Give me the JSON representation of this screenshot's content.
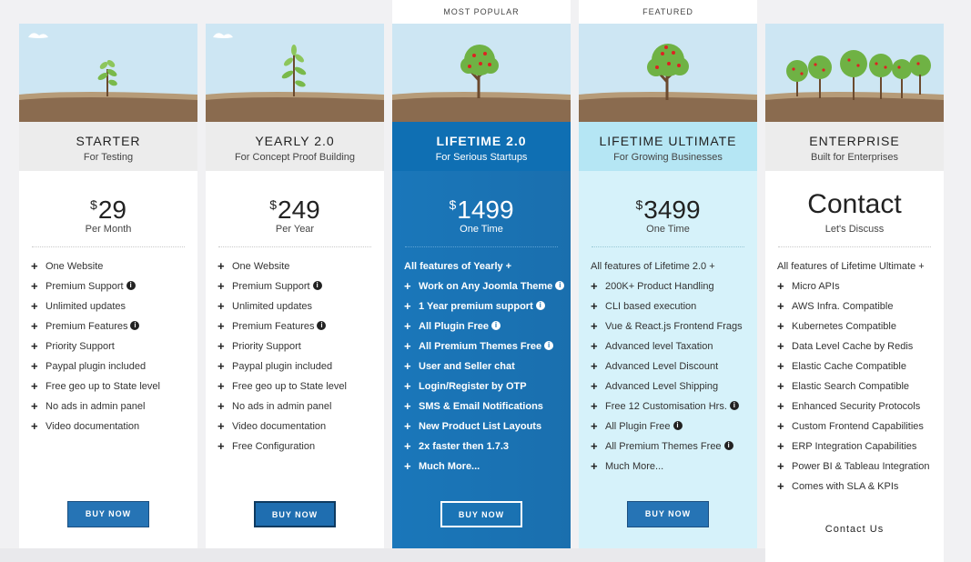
{
  "plans": [
    {
      "title": "STARTER",
      "subtitle": "For Testing",
      "currency": "$",
      "price": "29",
      "period": "Per Month",
      "features": [
        {
          "text": "One Website",
          "info": false
        },
        {
          "text": "Premium Support",
          "info": true
        },
        {
          "text": "Unlimited updates",
          "info": false
        },
        {
          "text": "Premium Features",
          "info": true
        },
        {
          "text": "Priority Support",
          "info": false
        },
        {
          "text": "Paypal plugin included",
          "info": false
        },
        {
          "text": "Free geo up to State level",
          "info": false
        },
        {
          "text": "No ads in admin panel",
          "info": false
        },
        {
          "text": "Video documentation",
          "info": false
        }
      ],
      "button": "BUY NOW"
    },
    {
      "title": "YEARLY 2.0",
      "subtitle": "For Concept Proof Building",
      "currency": "$",
      "price": "249",
      "period": "Per Year",
      "features": [
        {
          "text": "One Website",
          "info": false
        },
        {
          "text": "Premium Support",
          "info": true
        },
        {
          "text": "Unlimited updates",
          "info": false
        },
        {
          "text": "Premium Features",
          "info": true
        },
        {
          "text": "Priority Support",
          "info": false
        },
        {
          "text": "Paypal plugin included",
          "info": false
        },
        {
          "text": "Free geo up to State level",
          "info": false
        },
        {
          "text": "No ads in admin panel",
          "info": false
        },
        {
          "text": "Video documentation",
          "info": false
        },
        {
          "text": "Free Configuration",
          "info": false
        }
      ],
      "button": "BUY NOW"
    },
    {
      "ribbon": "MOST POPULAR",
      "title": "LIFETIME 2.0",
      "subtitle": "For Serious Startups",
      "currency": "$",
      "price": "1499",
      "period": "One Time",
      "intro": "All features of Yearly +",
      "features": [
        {
          "text": "Work on Any Joomla Theme",
          "info": true
        },
        {
          "text": "1 Year premium support",
          "info": true
        },
        {
          "text": "All Plugin Free",
          "info": true
        },
        {
          "text": "All Premium Themes Free",
          "info": true
        },
        {
          "text": "User and Seller chat",
          "info": false
        },
        {
          "text": "Login/Register by OTP",
          "info": false
        },
        {
          "text": "SMS & Email Notifications",
          "info": false
        },
        {
          "text": "New Product List Layouts",
          "info": false
        },
        {
          "text": "2x faster then 1.7.3",
          "info": false
        },
        {
          "text": "Much More...",
          "info": false
        }
      ],
      "button": "BUY NOW"
    },
    {
      "ribbon": "FEATURED",
      "title": "LIFETIME ULTIMATE",
      "subtitle": "For Growing Businesses",
      "currency": "$",
      "price": "3499",
      "period": "One Time",
      "intro": "All features of Lifetime 2.0 +",
      "features": [
        {
          "text": "200K+ Product Handling",
          "info": false
        },
        {
          "text": "CLI based execution",
          "info": false
        },
        {
          "text": "Vue & React.js Frontend Frags",
          "info": false
        },
        {
          "text": "Advanced level Taxation",
          "info": false
        },
        {
          "text": "Advanced Level Discount",
          "info": false
        },
        {
          "text": "Advanced Level Shipping",
          "info": false
        },
        {
          "text": "Free 12 Customisation Hrs.",
          "info": true
        },
        {
          "text": "All Plugin Free",
          "info": true
        },
        {
          "text": "All Premium Themes Free",
          "info": true
        },
        {
          "text": "Much More...",
          "info": false
        }
      ],
      "button": "BUY NOW"
    },
    {
      "title": "ENTERPRISE",
      "subtitle": "Built for Enterprises",
      "price": "Contact",
      "period": "Let's Discuss",
      "intro": "All features of Lifetime Ultimate +",
      "features": [
        {
          "text": "Micro APIs",
          "info": false
        },
        {
          "text": "AWS Infra. Compatible",
          "info": false
        },
        {
          "text": "Kubernetes Compatible",
          "info": false
        },
        {
          "text": "Data Level Cache by Redis",
          "info": false
        },
        {
          "text": "Elastic Cache Compatible",
          "info": false
        },
        {
          "text": "Elastic Search Compatible",
          "info": false
        },
        {
          "text": "Enhanced Security Protocols",
          "info": false
        },
        {
          "text": "Custom Frontend Capabilities",
          "info": false
        },
        {
          "text": "ERP Integration Capabilities",
          "info": false
        },
        {
          "text": "Power BI & Tableau Integration",
          "info": false
        },
        {
          "text": "Comes with SLA & KPIs",
          "info": false
        }
      ],
      "contact_link": "Contact Us"
    }
  ],
  "colors": {
    "primary_button": "#2674b5",
    "featured_blue": "#0f6fb3",
    "ultimate_light": "#d6f2fa",
    "sky": "#cde6f3",
    "soil": "#8a6b4f"
  },
  "icons": {
    "feature_bullet": "plus-icon",
    "info": "info-icon"
  }
}
